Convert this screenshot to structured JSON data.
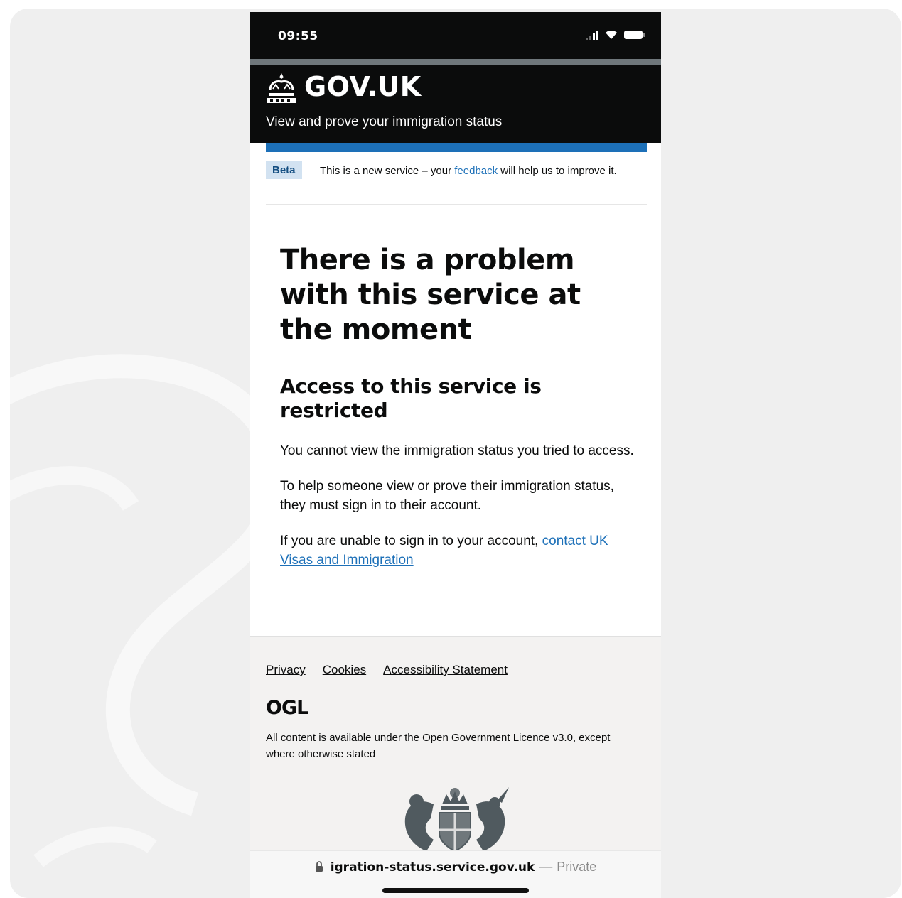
{
  "status_bar": {
    "time": "09:55"
  },
  "header": {
    "logo_text": "GOV.UK",
    "service_name": "View and prove your immigration status"
  },
  "beta_banner": {
    "tag": "Beta",
    "text_before": "This is a new service – your ",
    "link": "feedback",
    "text_after": " will help us to improve it."
  },
  "main": {
    "title": "There is a problem with this service at the moment",
    "subheading": "Access to this service is restricted",
    "para1": "You cannot view the immigration status you tried to access.",
    "para2": "To help someone view or prove their immigration status, they must sign in to their account.",
    "para3_before": "If you are unable to sign in to your account, ",
    "para3_link": "contact UK Visas and Immigration"
  },
  "footer": {
    "links": [
      "Privacy",
      "Cookies",
      "Accessibility Statement"
    ],
    "ogl": "OGL",
    "licence_before": "All content is available under the ",
    "licence_link": "Open Government Licence v3.0",
    "licence_after": ", except where otherwise stated"
  },
  "browser": {
    "url": "igration-status.service.gov.uk",
    "separator": "—",
    "mode": "Private"
  },
  "colors": {
    "header_black": "#0b0c0c",
    "gov_blue": "#1d70b8",
    "beta_tag_bg": "#d2e2f1",
    "footer_bg": "#f3f2f1",
    "page_bg": "#efefef"
  }
}
